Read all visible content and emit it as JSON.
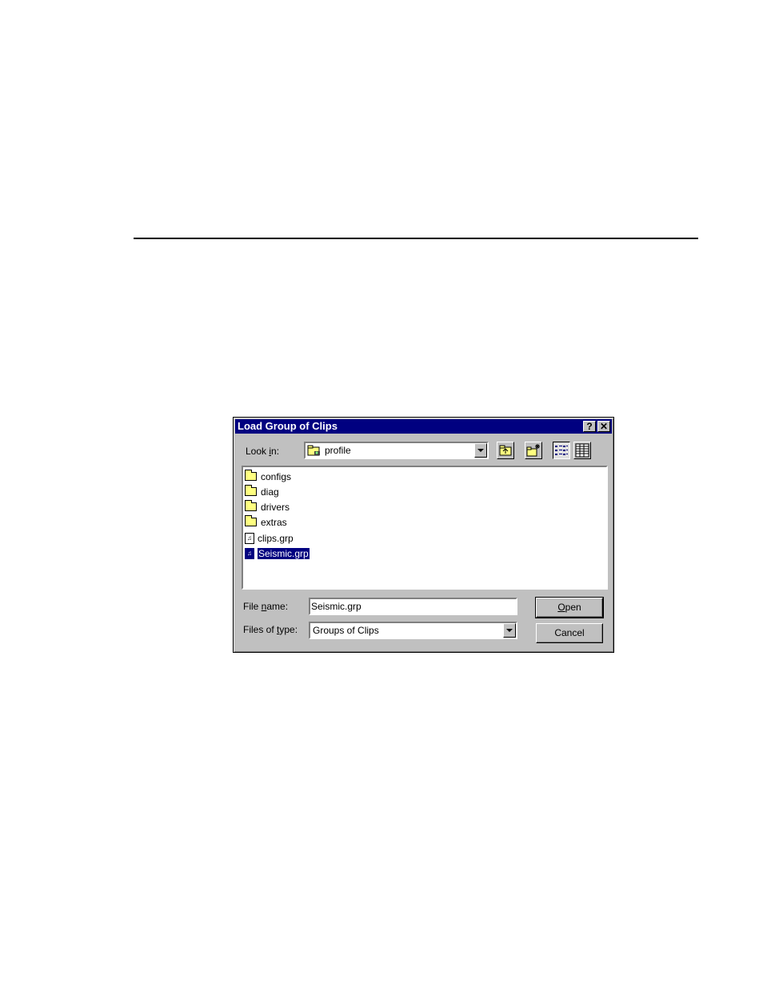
{
  "dialog": {
    "title": "Load Group of Clips",
    "help_label": "?",
    "close_label": "✕"
  },
  "look_in": {
    "label_pre": "Look ",
    "label_mnemonic": "i",
    "label_post": "n:",
    "value": "profile"
  },
  "files": [
    {
      "name": "configs",
      "type": "folder"
    },
    {
      "name": "diag",
      "type": "folder"
    },
    {
      "name": "drivers",
      "type": "folder"
    },
    {
      "name": "extras",
      "type": "folder"
    },
    {
      "name": "clips.grp",
      "type": "file"
    },
    {
      "name": "Seismic.grp",
      "type": "file",
      "selected": true
    }
  ],
  "file_name": {
    "label_pre": "File ",
    "label_mnemonic": "n",
    "label_post": "ame:",
    "value": "Seismic.grp"
  },
  "file_type": {
    "label_pre": "Files of ",
    "label_mnemonic": "t",
    "label_post": "ype:",
    "value": "Groups of Clips"
  },
  "buttons": {
    "open_mnemonic": "O",
    "open_rest": "pen",
    "cancel": "Cancel"
  },
  "colors": {
    "title_bar": "#000080",
    "dialog_face": "#c0c0c0",
    "selection": "#000080"
  }
}
